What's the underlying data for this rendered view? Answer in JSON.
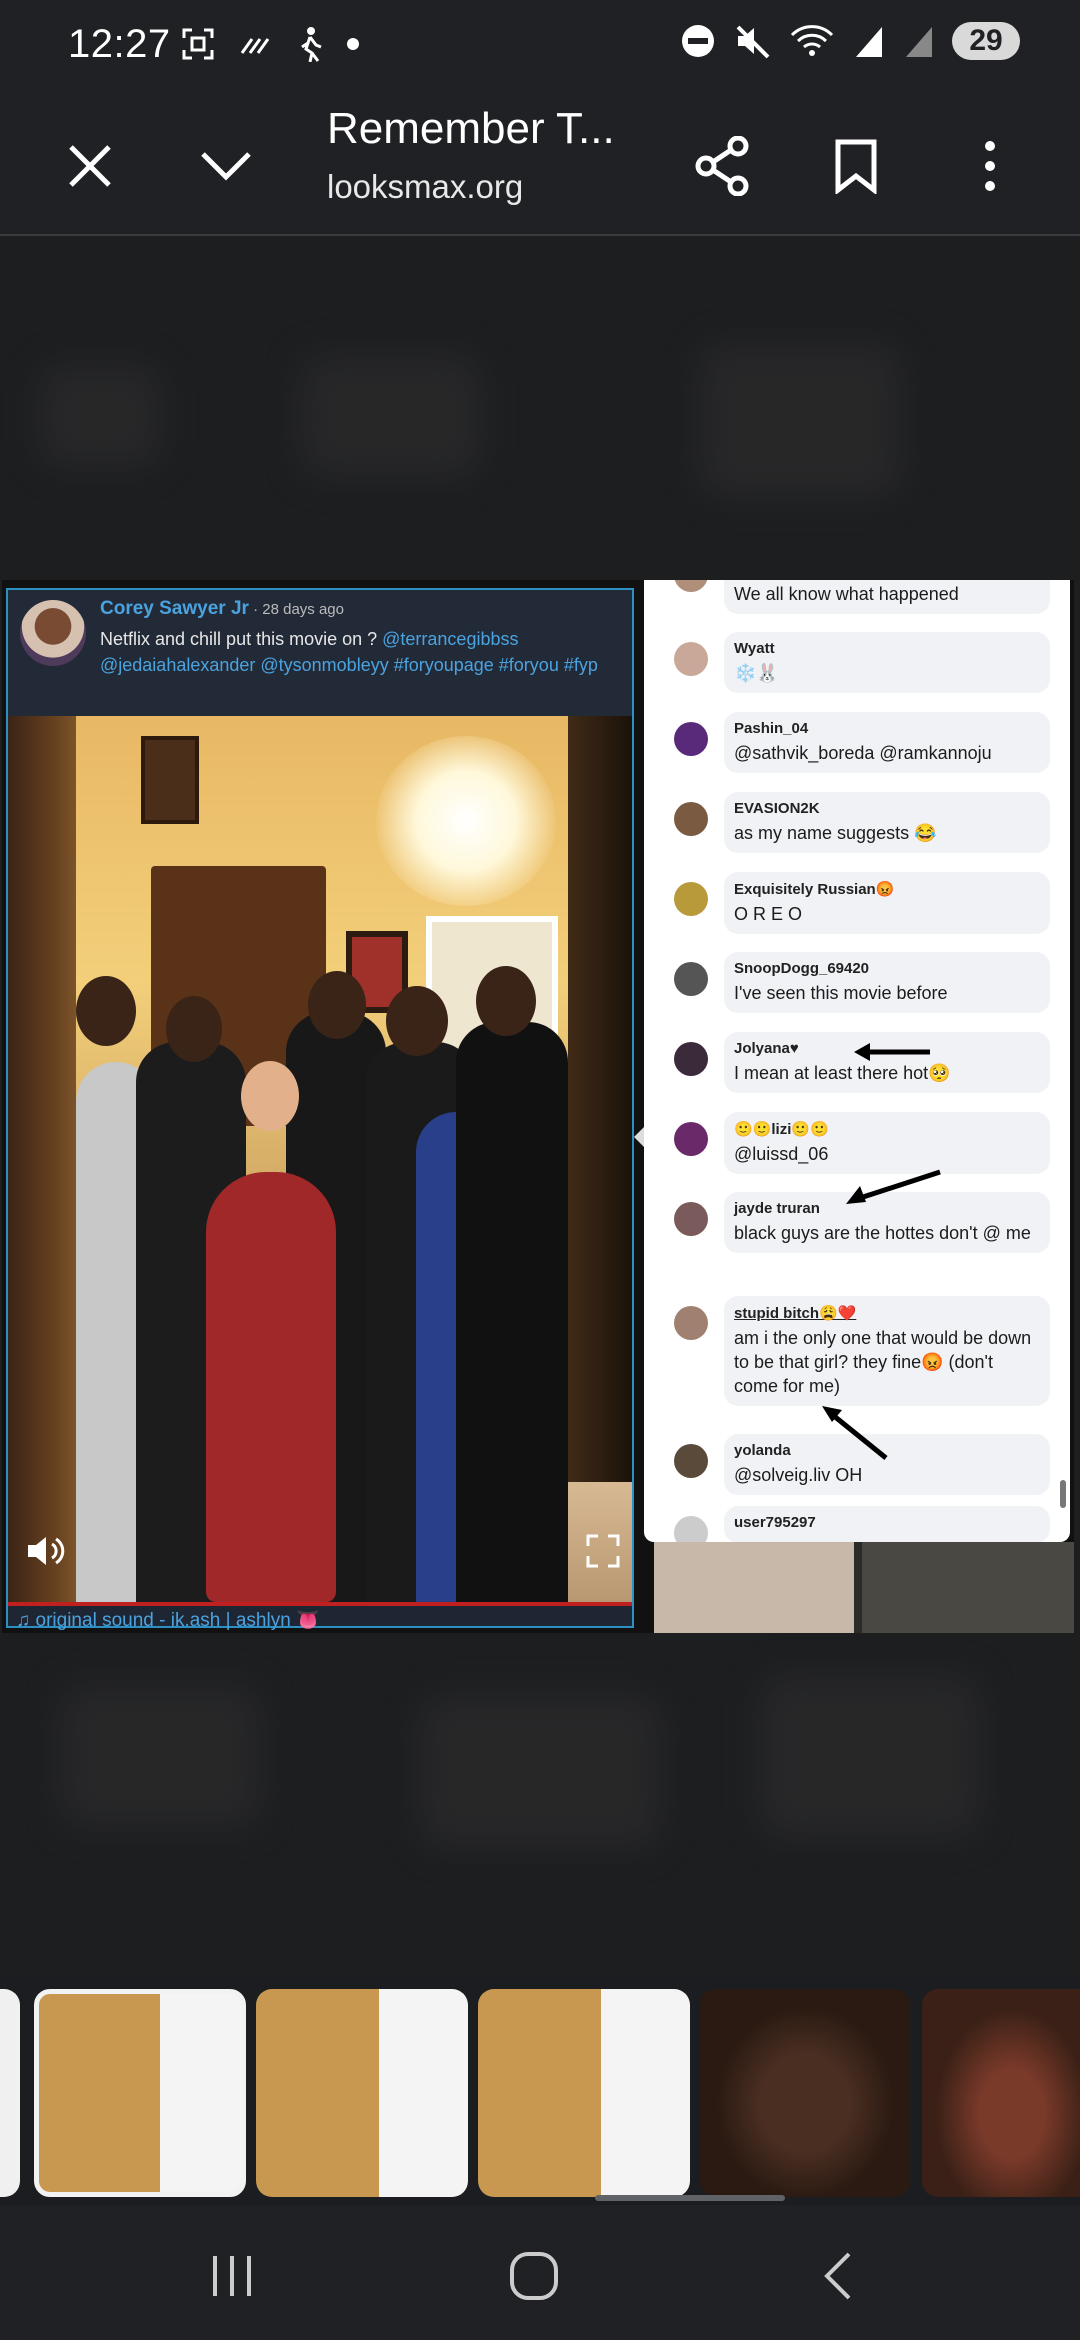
{
  "status_bar": {
    "time": "12:27",
    "battery": "29",
    "icons_left": [
      "screenshot-icon",
      "wifi-calling-icon",
      "walking-icon",
      "dot-icon"
    ],
    "icons_right": [
      "dnd-icon",
      "mute-icon",
      "wifi-icon",
      "signal-icon",
      "signal-icon"
    ]
  },
  "toolbar": {
    "title": "Remember T...",
    "url": "looksmax.org",
    "buttons": [
      "close-icon",
      "chevron-down-icon",
      "share-icon",
      "bookmark-icon",
      "more-icon"
    ]
  },
  "tiktok": {
    "user": "Corey Sawyer Jr",
    "time": " · 28 days ago",
    "caption_text": "Netflix and chill put this movie on ? ",
    "caption_tags": "@terrancegibbss @jedaiahalexander @tysonmobleyy #foryoupage #foryou #fyp",
    "sound": "♫ original sound - ik.ash | ashlyn 👅"
  },
  "comments": [
    {
      "name": "",
      "text": "We all know what happened",
      "avatar": "#b08f7a"
    },
    {
      "name": "Wyatt",
      "text": "❄️🐰",
      "avatar": "#c9a89a"
    },
    {
      "name": "Pashin_04",
      "text": "@sathvik_boreda @ramkannoju",
      "avatar": "#5a2a7a"
    },
    {
      "name": "EVASION2K",
      "text": "as my name suggests 😂",
      "avatar": "#7a5a40"
    },
    {
      "name": "Exquisitely Russian😡",
      "text": "O R E O",
      "avatar": "#b89a3a"
    },
    {
      "name": "SnoopDogg_69420",
      "text": "I've seen this movie before",
      "avatar": "#555"
    },
    {
      "name": "Jolyana♥",
      "text": "I mean at least there hot🥺",
      "avatar": "#3a2a3a"
    },
    {
      "name": "🙂🙂lizi🙂🙂",
      "text": "@luissd_06",
      "avatar": "#6a2a6a"
    },
    {
      "name": "jayde truran",
      "text": "black guys are the hottes don't @ me",
      "avatar": "#7a5a5a"
    },
    {
      "name": "stupid bitch😩❤️",
      "text": "am i the only one that would be down to be that girl? they fine😡 (don't come for me)",
      "avatar": "#a08070"
    },
    {
      "name": "yolanda",
      "text": "@solveig.liv OH",
      "avatar": "#5a4a3a"
    },
    {
      "name": "user795297",
      "text": "",
      "avatar": "#ccc"
    }
  ]
}
